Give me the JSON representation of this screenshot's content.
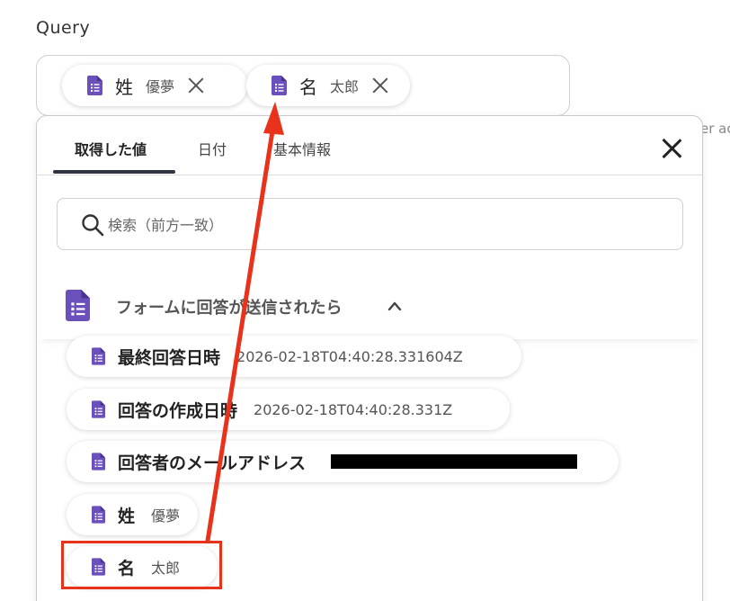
{
  "query": {
    "label": "Query",
    "chips": [
      {
        "name": "姓",
        "value": "優夢"
      },
      {
        "name": "名",
        "value": "太郎"
      }
    ]
  },
  "edge_text": "er ac",
  "panel": {
    "tabs": [
      {
        "label": "取得した値",
        "active": true
      },
      {
        "label": "日付",
        "active": false
      },
      {
        "label": "基本情報",
        "active": false
      }
    ],
    "search_placeholder": "検索（前方一致）",
    "section_title": "フォームに回答が送信されたら",
    "fields": [
      {
        "name": "最終回答日時",
        "value": "2026-02-18T04:40:28.331604Z"
      },
      {
        "name": "回答の作成日時",
        "value": "2026-02-18T04:40:28.331Z"
      },
      {
        "name": "回答者のメールアドレス",
        "value": "",
        "redacted": true
      },
      {
        "name": "姓",
        "value": "優夢"
      },
      {
        "name": "名",
        "value": "太郎"
      }
    ]
  },
  "colors": {
    "doc_icon": "#6b4fbb",
    "highlight": "#e8321c",
    "tab_underline": "#2e3440"
  },
  "icons": [
    "doc-icon",
    "close-icon",
    "search-icon",
    "chevron-up-icon"
  ]
}
